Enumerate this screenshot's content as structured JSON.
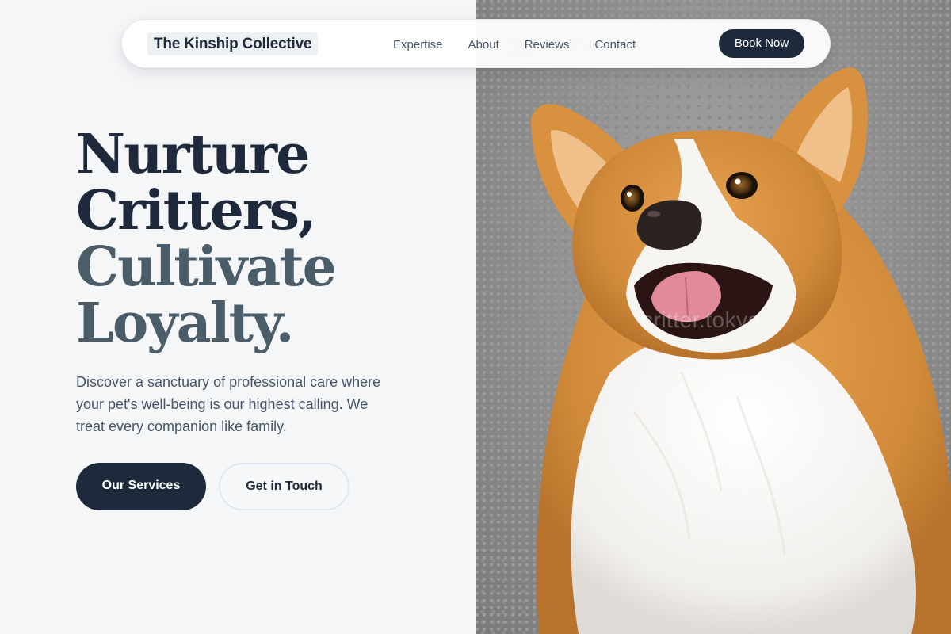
{
  "nav": {
    "brand": "The Kinship Collective",
    "links": [
      "Expertise",
      "About",
      "Reviews",
      "Contact"
    ],
    "cta": "Book Now"
  },
  "hero": {
    "headline": [
      "Nurture",
      "Critters,",
      "Cultivate",
      "Loyalty."
    ],
    "description": "Discover a sanctuary of professional care where your pet's well-being is our highest calling. We treat every companion like family.",
    "primary_button": "Our Services",
    "secondary_button": "Get in Touch"
  },
  "image": {
    "subject": "corgi-dog-photo",
    "watermark": "critter.tokyo"
  },
  "colors": {
    "page_bg": "#f4f6f8",
    "primary": "#1e293b",
    "headline_dark": "#1e293b",
    "headline_muted": "#4a5d68",
    "body_text": "#475569"
  }
}
